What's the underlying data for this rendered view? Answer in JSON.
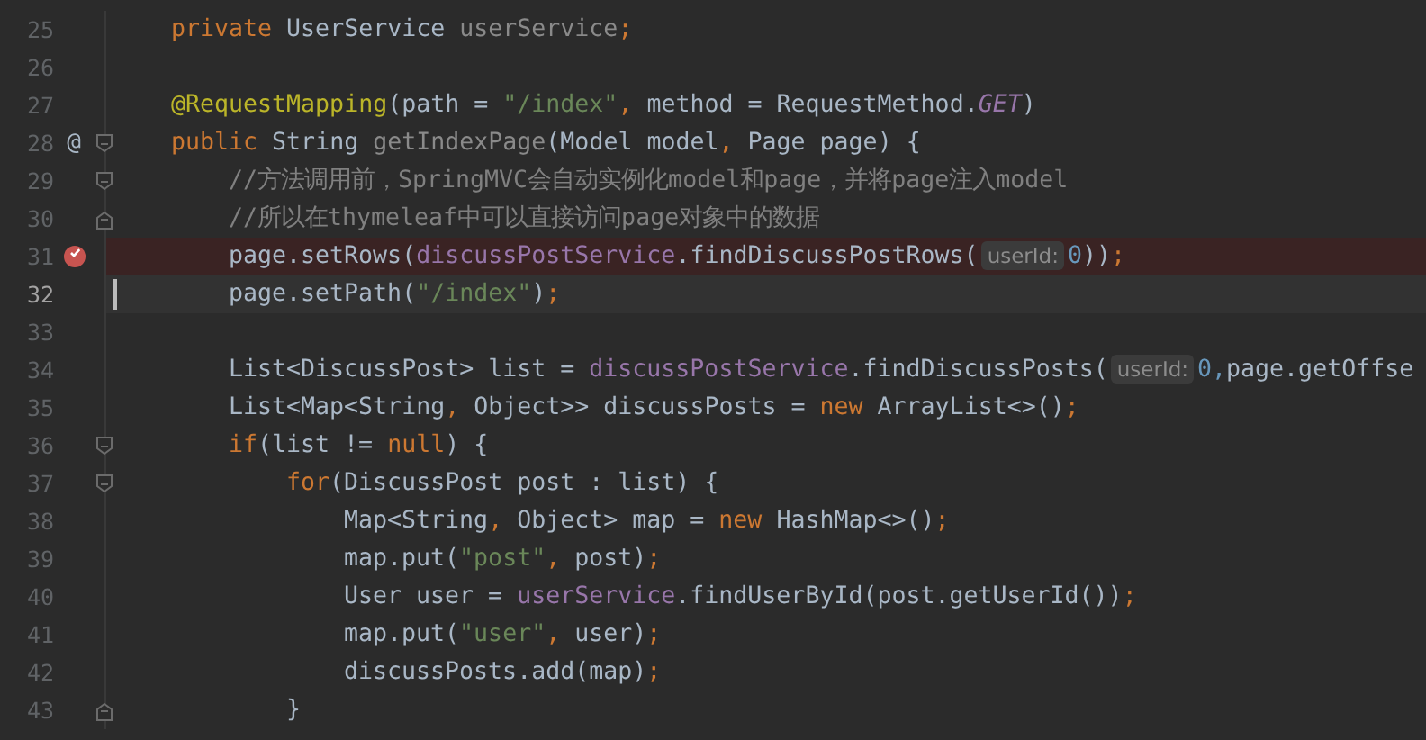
{
  "editor": {
    "lines": [
      {
        "number": "25",
        "breakpoint": false,
        "selected": false,
        "tokens": [
          {
            "kind": "keyword",
            "text": "private "
          },
          {
            "kind": "plain",
            "text": "UserService "
          },
          {
            "kind": "unused",
            "text": "userService"
          },
          {
            "kind": "keyword",
            "text": ";"
          }
        ]
      },
      {
        "number": "26",
        "breakpoint": false,
        "selected": false
      },
      {
        "number": "27",
        "breakpoint": false,
        "selected": false,
        "tokens": [
          {
            "kind": "annotation",
            "text": "@RequestMapping"
          },
          {
            "kind": "plain",
            "text": "(path = "
          },
          {
            "kind": "string",
            "text": "\"/index\""
          },
          {
            "kind": "keyword",
            "text": ", "
          },
          {
            "kind": "plain",
            "text": "method = RequestMethod."
          },
          {
            "kind": "constant",
            "text": "GET"
          },
          {
            "kind": "plain",
            "text": ")"
          }
        ]
      },
      {
        "number": "28",
        "kind": "fold-start",
        "breakpoint": false,
        "selected": false,
        "marker": "@",
        "tokens": [
          {
            "kind": "keyword",
            "text": "public "
          },
          {
            "kind": "plain",
            "text": "String "
          },
          {
            "kind": "unused",
            "text": "getIndexPage"
          },
          {
            "kind": "plain",
            "text": "(Model model"
          },
          {
            "kind": "keyword",
            "text": ", "
          },
          {
            "kind": "plain",
            "text": "Page page) {"
          }
        ],
        "children": [
          {
            "number": "29",
            "kind": "fold-start",
            "breakpoint": false,
            "selected": false,
            "tokens": [
              {
                "kind": "comment",
                "text": "//方法调用前，SpringMVC会自动实例化model和page，并将page注入model"
              }
            ]
          },
          {
            "number": "30",
            "kind": "fold-end",
            "breakpoint": false,
            "selected": false,
            "tokens": [
              {
                "kind": "comment",
                "text": "//所以在thymeleaf中可以直接访问page对象中的数据"
              }
            ]
          },
          {
            "number": "31",
            "breakpoint": true,
            "selected": false,
            "tokens": [
              {
                "kind": "plain",
                "text": "page.setRows("
              },
              {
                "kind": "field",
                "text": "discussPostService"
              },
              {
                "kind": "plain",
                "text": ".findDiscussPostRows("
              },
              {
                "kind": "hint",
                "text": "userId:"
              },
              {
                "kind": "number",
                "text": "0"
              },
              {
                "kind": "plain",
                "text": "))"
              },
              {
                "kind": "keyword",
                "text": ";"
              }
            ]
          },
          {
            "number": "32",
            "breakpoint": false,
            "selected": true,
            "tokens": [
              {
                "kind": "plain",
                "text": "page.setPath("
              },
              {
                "kind": "string",
                "text": "\"/index\""
              },
              {
                "kind": "plain",
                "text": ")"
              },
              {
                "kind": "keyword",
                "text": ";"
              }
            ]
          },
          {
            "number": "33",
            "breakpoint": false,
            "selected": false
          },
          {
            "number": "34",
            "breakpoint": false,
            "selected": false,
            "tokens": [
              {
                "kind": "plain",
                "text": "List<DiscussPost> list = "
              },
              {
                "kind": "field",
                "text": "discussPostService"
              },
              {
                "kind": "plain",
                "text": ".findDiscussPosts("
              },
              {
                "kind": "hint",
                "text": "userId:"
              },
              {
                "kind": "number",
                "text": "0,"
              },
              {
                "kind": "plain",
                "text": "page.getOffse"
              }
            ]
          },
          {
            "number": "35",
            "breakpoint": false,
            "selected": false,
            "tokens": [
              {
                "kind": "plain",
                "text": "List<Map<String"
              },
              {
                "kind": "keyword",
                "text": ", "
              },
              {
                "kind": "plain",
                "text": "Object>> discussPosts = "
              },
              {
                "kind": "keyword",
                "text": "new "
              },
              {
                "kind": "plain",
                "text": "ArrayList<>()"
              },
              {
                "kind": "keyword",
                "text": ";"
              }
            ]
          },
          {
            "number": "36",
            "kind": "fold-start",
            "breakpoint": false,
            "selected": false,
            "tokens": [
              {
                "kind": "keyword",
                "text": "if"
              },
              {
                "kind": "plain",
                "text": "(list != "
              },
              {
                "kind": "keyword",
                "text": "null"
              },
              {
                "kind": "plain",
                "text": ") {"
              }
            ],
            "children": [
              {
                "number": "37",
                "kind": "fold-start",
                "breakpoint": false,
                "selected": false,
                "tokens": [
                  {
                    "kind": "keyword",
                    "text": "for"
                  },
                  {
                    "kind": "plain",
                    "text": "(DiscussPost post : list) {"
                  }
                ],
                "children": [
                  {
                    "number": "38",
                    "breakpoint": false,
                    "selected": false,
                    "tokens": [
                      {
                        "kind": "plain",
                        "text": "Map<String"
                      },
                      {
                        "kind": "keyword",
                        "text": ", "
                      },
                      {
                        "kind": "plain",
                        "text": "Object> map = "
                      },
                      {
                        "kind": "keyword",
                        "text": "new "
                      },
                      {
                        "kind": "plain",
                        "text": "HashMap<>()"
                      },
                      {
                        "kind": "keyword",
                        "text": ";"
                      }
                    ]
                  },
                  {
                    "number": "39",
                    "breakpoint": false,
                    "selected": false,
                    "tokens": [
                      {
                        "kind": "plain",
                        "text": "map.put("
                      },
                      {
                        "kind": "string",
                        "text": "\"post\""
                      },
                      {
                        "kind": "keyword",
                        "text": ", "
                      },
                      {
                        "kind": "plain",
                        "text": "post)"
                      },
                      {
                        "kind": "keyword",
                        "text": ";"
                      }
                    ]
                  },
                  {
                    "number": "40",
                    "breakpoint": false,
                    "selected": false,
                    "tokens": [
                      {
                        "kind": "plain",
                        "text": "User user = "
                      },
                      {
                        "kind": "field",
                        "text": "userService"
                      },
                      {
                        "kind": "plain",
                        "text": ".findUserById(post.getUserId())"
                      },
                      {
                        "kind": "keyword",
                        "text": ";"
                      }
                    ]
                  },
                  {
                    "number": "41",
                    "breakpoint": false,
                    "selected": false,
                    "tokens": [
                      {
                        "kind": "plain",
                        "text": "map.put("
                      },
                      {
                        "kind": "string",
                        "text": "\"user\""
                      },
                      {
                        "kind": "keyword",
                        "text": ", "
                      },
                      {
                        "kind": "plain",
                        "text": "user)"
                      },
                      {
                        "kind": "keyword",
                        "text": ";"
                      }
                    ]
                  },
                  {
                    "number": "42",
                    "breakpoint": false,
                    "selected": false,
                    "tokens": [
                      {
                        "kind": "plain",
                        "text": "discussPosts.add(map)"
                      },
                      {
                        "kind": "keyword",
                        "text": ";"
                      }
                    ]
                  }
                ]
              },
              {
                "number": "43",
                "kind": "fold-end",
                "breakpoint": false,
                "selected": false,
                "tokens": [
                  {
                    "kind": "plain",
                    "text": "}"
                  }
                ]
              }
            ]
          }
        ]
      }
    ]
  }
}
